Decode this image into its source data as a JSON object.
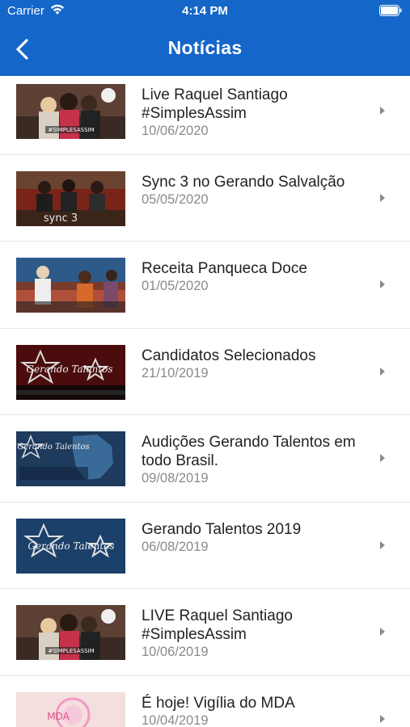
{
  "status_bar": {
    "carrier": "Carrier",
    "time": "4:14 PM"
  },
  "header": {
    "title": "Notícias",
    "back_icon": "chevron-left-icon"
  },
  "colors": {
    "header_bg": "#1466c8",
    "title_text": "#222222",
    "date_text": "#8a8a8a"
  },
  "news": [
    {
      "title": "Live Raquel Santiago #SimplesAssim",
      "date": "10/06/2020",
      "thumb_text": "#SIMPLESASSIM"
    },
    {
      "title": "Sync 3 no Gerando Salvalção",
      "date": "05/05/2020",
      "thumb_text": "sync 3"
    },
    {
      "title": "Receita Panqueca Doce",
      "date": "01/05/2020",
      "thumb_text": ""
    },
    {
      "title": "Candidatos Selecionados",
      "date": "21/10/2019",
      "thumb_text": "Gerando Talentos"
    },
    {
      "title": "Audições Gerando Talentos em todo Brasil.",
      "date": "09/08/2019",
      "thumb_text": "Gerando Talentos"
    },
    {
      "title": "Gerando Talentos 2019",
      "date": "06/08/2019",
      "thumb_text": "Gerando Talentos"
    },
    {
      "title": "LIVE  Raquel Santiago #SimplesAssim",
      "date": "10/06/2019",
      "thumb_text": "#SIMPLESASSIM"
    },
    {
      "title": "É hoje! Vigília do MDA",
      "date": "10/04/2019",
      "thumb_text": "MDA"
    }
  ]
}
